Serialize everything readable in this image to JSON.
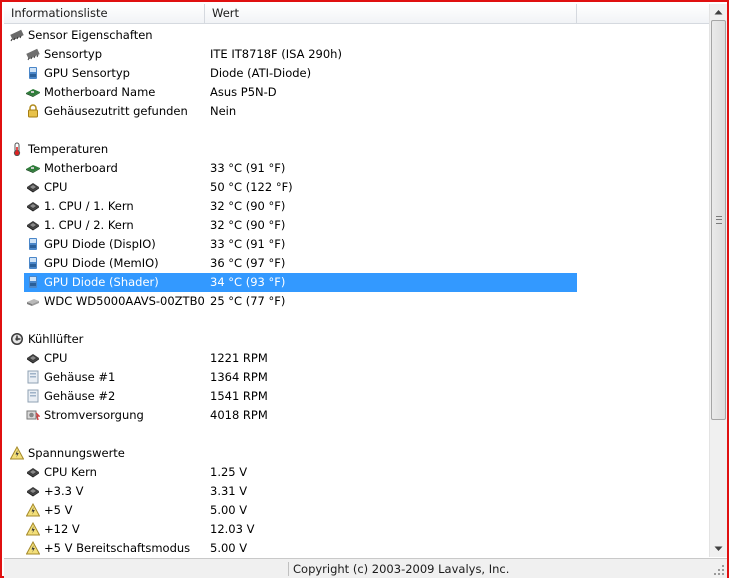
{
  "header": {
    "col_info": "Informationsliste",
    "col_value": "Wert"
  },
  "status": {
    "copyright": "Copyright (c) 2003-2009 Lavalys, Inc."
  },
  "rows": [
    {
      "type": "group",
      "icon": "sensor",
      "label": "Sensor Eigenschaften",
      "value": ""
    },
    {
      "type": "item",
      "icon": "chip",
      "label": "Sensortyp",
      "value": "ITE IT8718F  (ISA 290h)"
    },
    {
      "type": "item",
      "icon": "gpu",
      "label": "GPU Sensortyp",
      "value": "Diode  (ATI-Diode)"
    },
    {
      "type": "item",
      "icon": "board",
      "label": "Motherboard Name",
      "value": "Asus P5N-D"
    },
    {
      "type": "item",
      "icon": "lock",
      "label": "Gehäusezutritt gefunden",
      "value": "Nein"
    },
    {
      "type": "blank",
      "label": "",
      "value": ""
    },
    {
      "type": "group",
      "icon": "thermo",
      "label": "Temperaturen",
      "value": ""
    },
    {
      "type": "item",
      "icon": "board",
      "label": "Motherboard",
      "value": "33 °C  (91 °F)"
    },
    {
      "type": "item",
      "icon": "cpu",
      "label": "CPU",
      "value": "50 °C  (122 °F)"
    },
    {
      "type": "item",
      "icon": "cpu",
      "label": "1. CPU / 1. Kern",
      "value": "32 °C  (90 °F)"
    },
    {
      "type": "item",
      "icon": "cpu",
      "label": "1. CPU / 2. Kern",
      "value": "32 °C  (90 °F)"
    },
    {
      "type": "item",
      "icon": "gpu",
      "label": "GPU Diode (DispIO)",
      "value": "33 °C  (91 °F)"
    },
    {
      "type": "item",
      "icon": "gpu",
      "label": "GPU Diode (MemIO)",
      "value": "36 °C  (97 °F)"
    },
    {
      "type": "item",
      "icon": "gpu",
      "label": "GPU Diode (Shader)",
      "value": "34 °C  (93 °F)",
      "selected": true
    },
    {
      "type": "item",
      "icon": "hdd",
      "label": "WDC WD5000AAVS-00ZTB0",
      "value": "25 °C  (77 °F)"
    },
    {
      "type": "blank",
      "label": "",
      "value": ""
    },
    {
      "type": "group",
      "icon": "fan",
      "label": "Kühllüfter",
      "value": ""
    },
    {
      "type": "item",
      "icon": "cpu",
      "label": "CPU",
      "value": "1221 RPM"
    },
    {
      "type": "item",
      "icon": "case",
      "label": "Gehäuse #1",
      "value": "1364 RPM"
    },
    {
      "type": "item",
      "icon": "case",
      "label": "Gehäuse #2",
      "value": "1541 RPM"
    },
    {
      "type": "item",
      "icon": "psu",
      "label": "Stromversorgung",
      "value": "4018 RPM"
    },
    {
      "type": "blank",
      "label": "",
      "value": ""
    },
    {
      "type": "group",
      "icon": "volt",
      "label": "Spannungswerte",
      "value": ""
    },
    {
      "type": "item",
      "icon": "cpu",
      "label": "CPU Kern",
      "value": "1.25 V"
    },
    {
      "type": "item",
      "icon": "cpu",
      "label": "+3.3 V",
      "value": "3.31 V"
    },
    {
      "type": "item",
      "icon": "volt",
      "label": "+5 V",
      "value": "5.00 V"
    },
    {
      "type": "item",
      "icon": "volt",
      "label": "+12 V",
      "value": "12.03 V"
    },
    {
      "type": "item",
      "icon": "volt",
      "label": "+5 V Bereitschaftsmodus",
      "value": "5.00 V"
    }
  ]
}
